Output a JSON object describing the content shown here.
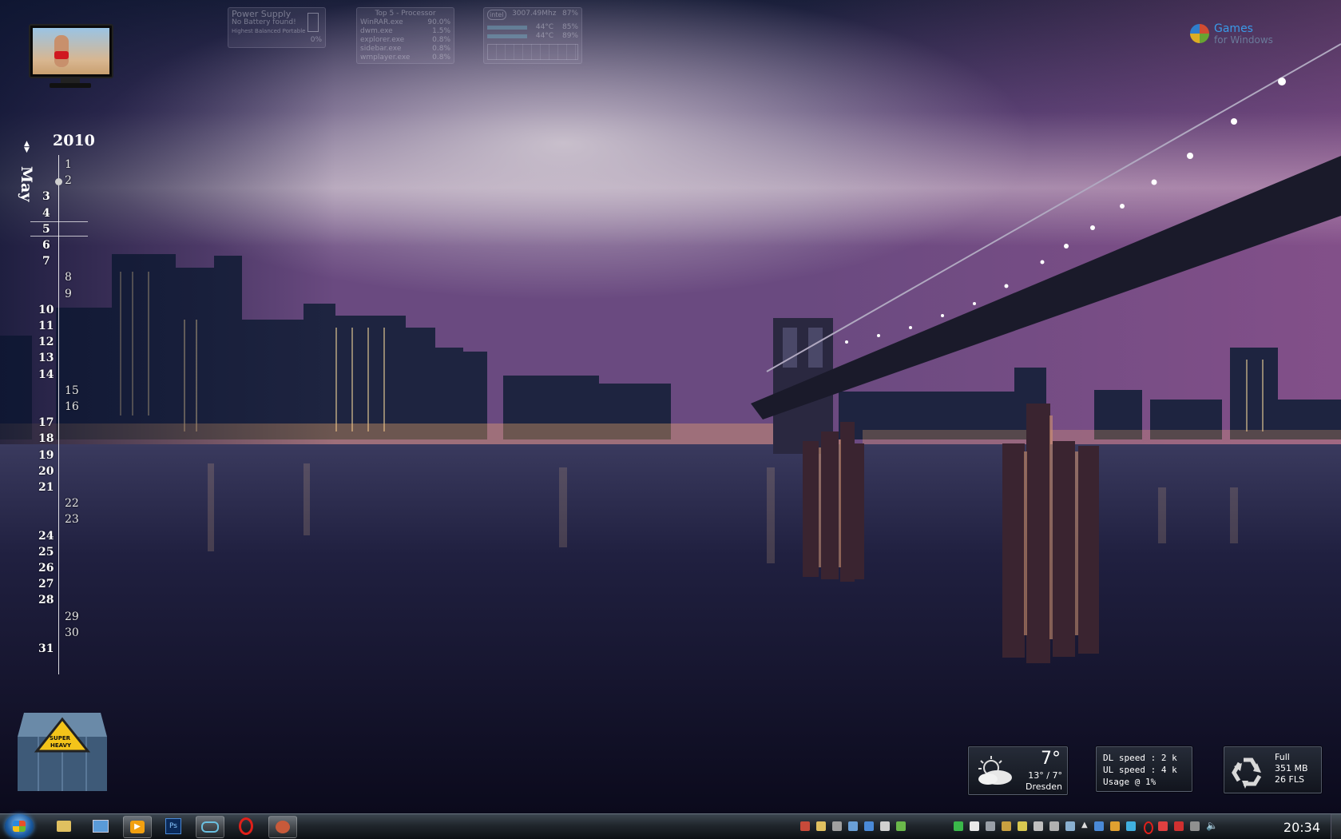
{
  "desktop": {
    "calendar": {
      "year": "2010",
      "month": "May",
      "selected_day": "2",
      "days": [
        "1",
        "2",
        "3",
        "4",
        "5",
        "6",
        "7",
        "8",
        "9",
        "10",
        "11",
        "12",
        "13",
        "14",
        "15",
        "16",
        "17",
        "18",
        "19",
        "20",
        "21",
        "22",
        "23",
        "24",
        "25",
        "26",
        "27",
        "28",
        "29",
        "30",
        "31"
      ]
    },
    "power_gadget": {
      "title": "Power Supply",
      "status": "No Battery found!",
      "plan": "Highest Balanced Portable",
      "percent": "0%"
    },
    "processor_gadget": {
      "title": "Top 5 - Processor",
      "rows": [
        {
          "name": "WinRAR.exe",
          "value": "90.0%"
        },
        {
          "name": "dwm.exe",
          "value": "1.5%"
        },
        {
          "name": "explorer.exe",
          "value": "0.8%"
        },
        {
          "name": "sidebar.exe",
          "value": "0.8%"
        },
        {
          "name": "wmplayer.exe",
          "value": "0.8%"
        }
      ]
    },
    "cpu_gadget": {
      "clock": "3007.49Mhz",
      "usage": "87%",
      "core1_temp": "44°C",
      "core1_load": "85%",
      "core2_temp": "44°C",
      "core2_load": "89%"
    },
    "games_logo": {
      "line1": "Games",
      "line2": "for Windows"
    },
    "weather": {
      "temp": "7°",
      "range": "13° / 7°",
      "city": "Dresden"
    },
    "network": {
      "dl": "DL speed : 2 k",
      "ul": "UL speed : 4 k",
      "usage": "Usage @ 1%"
    },
    "recycle": {
      "status": "Full",
      "size": "351 MB",
      "files": "26 FLS"
    },
    "container_label": {
      "line1": "SUPER",
      "line2": "HEAVY"
    }
  },
  "taskbar": {
    "clock": "20:34",
    "icons": [
      "folder-icon",
      "explorer-icon",
      "media-player-icon",
      "photoshop-icon",
      "network-icon",
      "opera-icon",
      "paint-icon"
    ]
  },
  "colors": {
    "accent": "#4a8fd9",
    "sky": "#7a5a8c"
  }
}
